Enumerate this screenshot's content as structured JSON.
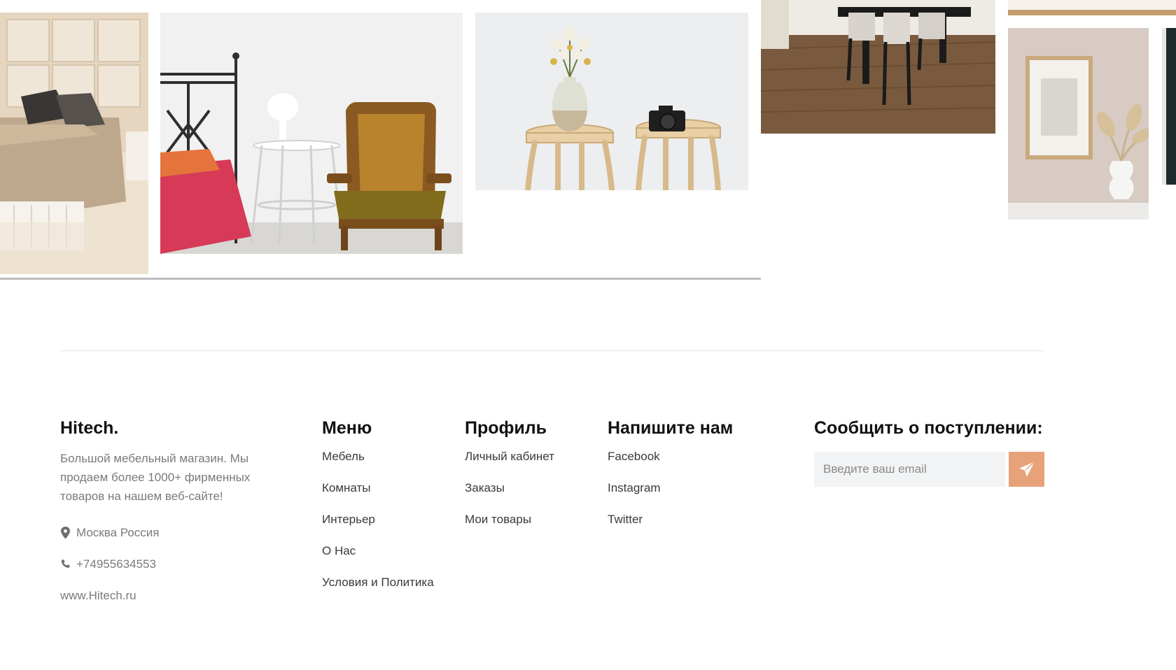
{
  "gallery": {
    "photos": [
      {
        "name": "bedroom-photo"
      },
      {
        "name": "armchair-photo"
      },
      {
        "name": "stools-photo"
      },
      {
        "name": "dining-photo"
      },
      {
        "name": "frame-photo"
      }
    ]
  },
  "footer": {
    "brand": {
      "title": "Hitech.",
      "description": "Большой мебельный магазин. Мы продаем более 1000+ фирменных товаров на нашем веб-сайте!",
      "location": "Москва Россия",
      "phone": "+74955634553",
      "website": "www.Hitech.ru"
    },
    "menu": {
      "title": "Меню",
      "items": [
        "Мебель",
        "Комнаты",
        "Интерьер",
        "О Нас",
        "Условия и Политика"
      ]
    },
    "profile": {
      "title": "Профиль",
      "items": [
        "Личный кабинет",
        "Заказы",
        "Мои товары"
      ]
    },
    "contact": {
      "title": "Напишите нам",
      "items": [
        "Facebook",
        "Instagram",
        "Twitter"
      ]
    },
    "subscribe": {
      "title": "Сообщить о поступлении:",
      "placeholder": "Введите ваш email"
    }
  },
  "colors": {
    "accent": "#e8a27a",
    "muted_text": "#7a7a7a",
    "input_bg": "#f2f3f4"
  },
  "icons": {
    "location": "map-pin-icon",
    "phone": "phone-icon",
    "send": "paper-plane-icon"
  }
}
